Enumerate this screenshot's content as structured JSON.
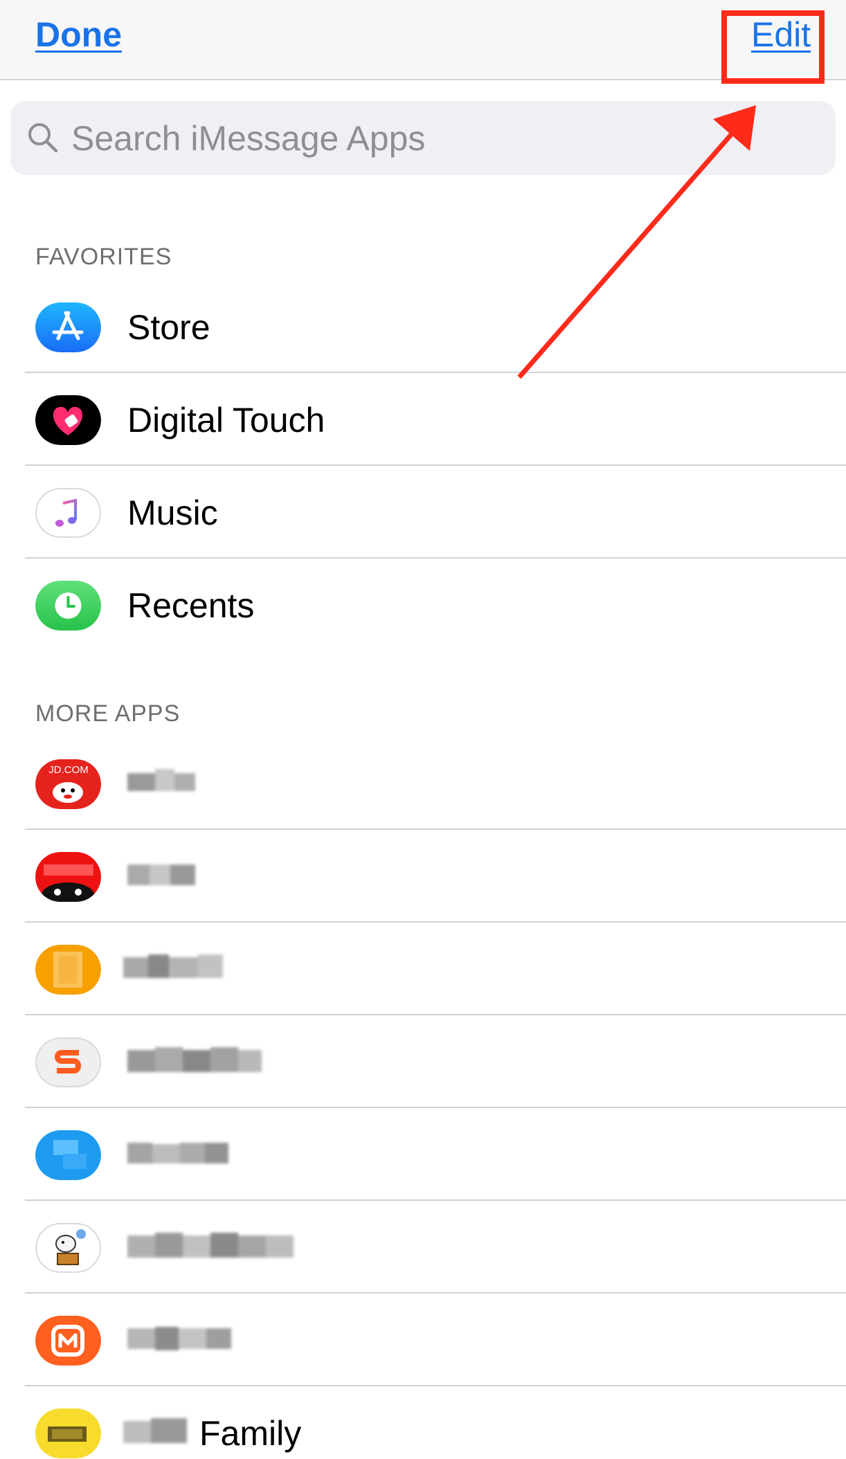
{
  "nav": {
    "done_label": "Done",
    "edit_label": "Edit"
  },
  "search": {
    "placeholder": "Search iMessage Apps"
  },
  "sections": {
    "favorites_title": "FAVORITES",
    "more_apps_title": "MORE APPS"
  },
  "favorites": [
    {
      "label": "Store",
      "icon": "app-store-icon"
    },
    {
      "label": "Digital Touch",
      "icon": "digital-touch-icon"
    },
    {
      "label": "Music",
      "icon": "music-note-icon"
    },
    {
      "label": "Recents",
      "icon": "clock-icon"
    }
  ],
  "more_apps": [
    {
      "label": "",
      "icon": "jd-com-icon",
      "icon_text": "JD.COM"
    },
    {
      "label": "",
      "icon": "tmall-cat-icon"
    },
    {
      "label": "",
      "icon": "orange-app-icon"
    },
    {
      "label": "",
      "icon": "sogou-s-icon"
    },
    {
      "label": "",
      "icon": "blue-app-icon"
    },
    {
      "label": "",
      "icon": "dog-mascot-icon"
    },
    {
      "label": "",
      "icon": "mango-tv-icon"
    },
    {
      "label": "Family",
      "icon": "yellow-app-icon"
    }
  ],
  "colors": {
    "accent": "#1a73e8",
    "annotation": "#ff2a1a",
    "separator": "#d1d1d6"
  }
}
